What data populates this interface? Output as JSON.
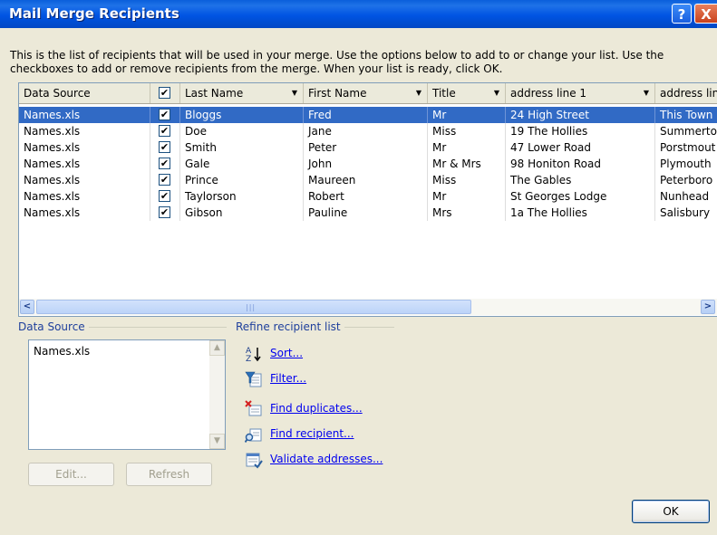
{
  "window": {
    "title": "Mail Merge Recipients",
    "help_label": "?",
    "close_label": "X"
  },
  "intro_text": "This is the list of recipients that will be used in your merge.  Use the options below to add to or change your list.  Use the checkboxes to add or remove recipients from the merge.  When your list is ready, click OK.",
  "table": {
    "columns": [
      "Data Source",
      "Last Name",
      "First Name",
      "Title",
      "address line 1",
      "address lin"
    ],
    "rows": [
      {
        "source": "Names.xls",
        "checked": true,
        "last": "Bloggs",
        "first": "Fred",
        "title": "Mr",
        "addr1": "24 High Street",
        "addr2": "This Town"
      },
      {
        "source": "Names.xls",
        "checked": true,
        "last": "Doe",
        "first": "Jane",
        "title": "Miss",
        "addr1": "19 The Hollies",
        "addr2": "Summerto"
      },
      {
        "source": "Names.xls",
        "checked": true,
        "last": "Smith",
        "first": "Peter",
        "title": "Mr",
        "addr1": "47 Lower Road",
        "addr2": "Porstmout"
      },
      {
        "source": "Names.xls",
        "checked": true,
        "last": "Gale",
        "first": "John",
        "title": "Mr & Mrs",
        "addr1": "98 Honiton Road",
        "addr2": "Plymouth"
      },
      {
        "source": "Names.xls",
        "checked": true,
        "last": "Prince",
        "first": "Maureen",
        "title": "Miss",
        "addr1": "The Gables",
        "addr2": "Peterboro"
      },
      {
        "source": "Names.xls",
        "checked": true,
        "last": "Taylorson",
        "first": "Robert",
        "title": "Mr",
        "addr1": "St Georges Lodge",
        "addr2": "Nunhead"
      },
      {
        "source": "Names.xls",
        "checked": true,
        "last": "Gibson",
        "first": "Pauline",
        "title": "Mrs",
        "addr1": "1a The Hollies",
        "addr2": "Salisbury"
      }
    ],
    "selected_row": 0,
    "scroll_grip": "|||"
  },
  "data_source": {
    "label": "Data Source",
    "items": [
      "Names.xls"
    ],
    "edit_label": "Edit...",
    "refresh_label": "Refresh"
  },
  "refine": {
    "label": "Refine recipient list",
    "actions": [
      {
        "label": "Sort...",
        "icon": "sort-az-icon"
      },
      {
        "label": "Filter...",
        "icon": "filter-icon"
      },
      {
        "label": "Find duplicates...",
        "icon": "find-duplicates-icon"
      },
      {
        "label": "Find recipient...",
        "icon": "find-recipient-icon"
      },
      {
        "label": "Validate addresses...",
        "icon": "validate-addresses-icon"
      }
    ]
  },
  "ok_label": "OK",
  "colors": {
    "title_blue": "#0054E3",
    "selection": "#316AC5",
    "link": "#0000EE",
    "group_label": "#1E3F9C"
  }
}
